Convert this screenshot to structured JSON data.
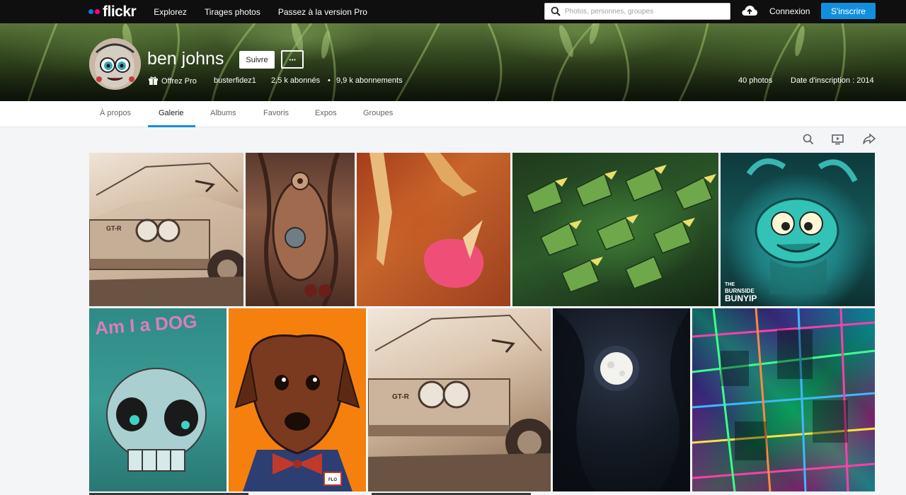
{
  "header": {
    "logo_text": "flickr",
    "nav": [
      "Explorez",
      "Tirages photos",
      "Passez à la version Pro"
    ],
    "search_placeholder": "Photos, personnes, groupes",
    "login_label": "Connexion",
    "signup_label": "S'inscrire"
  },
  "profile": {
    "name": "ben johns",
    "follow_label": "Suivre",
    "more_label": "···",
    "pro_label": "Offrez Pro",
    "handle": "busterfidez1",
    "followers": "2,5 k abonnés",
    "bullet": "•",
    "following": "9,9 k abonnements",
    "photo_count": "40 photos",
    "joined": "Date d'inscription : 2014"
  },
  "tabs": [
    "À propos",
    "Galerie",
    "Albums",
    "Favoris",
    "Expos",
    "Groupes"
  ],
  "active_tab": "Galerie",
  "toolbar_icons": [
    "search-icon",
    "slideshow-icon",
    "share-icon"
  ],
  "gallery": {
    "overlay_text": {
      "photo5_line1": "THE",
      "photo5_line2": "BURNSIDE",
      "photo5_line3": "BUNYIP",
      "photo6_title": "Am I a DOG",
      "car_badge": "GT-R",
      "dog_tag": "FLO"
    }
  },
  "colors": {
    "topbar": "#0f0f10",
    "accent_blue": "#128fdc",
    "flickr_blue": "#1875d6",
    "flickr_pink": "#ff0084"
  }
}
